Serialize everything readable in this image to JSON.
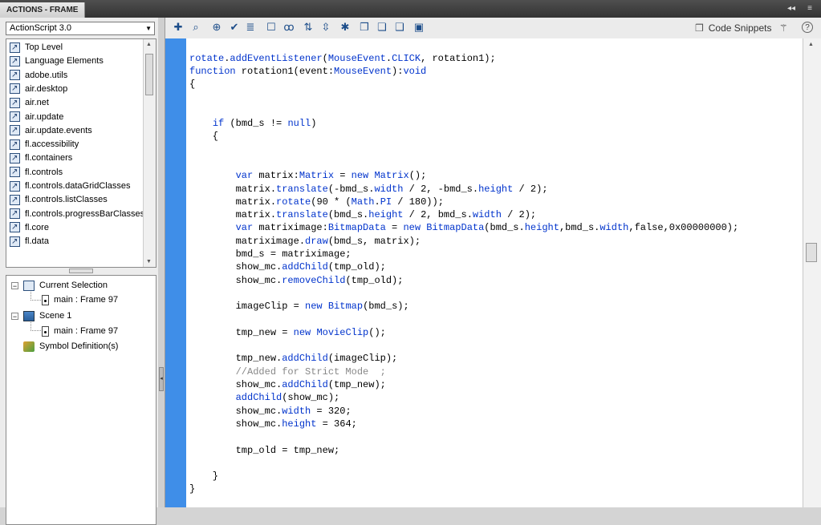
{
  "window": {
    "title": "ACTIONS - FRAME",
    "controls": {
      "collapse": "◂◂",
      "menu": "≡"
    }
  },
  "left_panel": {
    "language_select": {
      "value": "ActionScript 3.0",
      "arrow": "▼"
    },
    "library_items": [
      "Top Level",
      "Language Elements",
      "adobe.utils",
      "air.desktop",
      "air.net",
      "air.update",
      "air.update.events",
      "fl.accessibility",
      "fl.containers",
      "fl.controls",
      "fl.controls.dataGridClasses",
      "fl.controls.listClasses",
      "fl.controls.progressBarClasses",
      "fl.core",
      "fl.data"
    ],
    "tree": {
      "current_selection": "Current Selection",
      "current_frame": "main : Frame 97",
      "scene": "Scene 1",
      "scene_frame": "main : Frame 97",
      "symbol_definitions": "Symbol Definition(s)",
      "expander_minus": "−"
    }
  },
  "toolbar": {
    "code_snippets_label": "Code Snippets",
    "help": "?",
    "buttons": [
      {
        "name": "add-statement",
        "glyph": "✚"
      },
      {
        "name": "find",
        "glyph": "⌕"
      },
      {
        "name": "insert-target-path",
        "glyph": "⊕"
      },
      {
        "name": "check-syntax",
        "glyph": "✔"
      },
      {
        "name": "auto-format",
        "glyph": "≣"
      },
      {
        "name": "show-code-hint",
        "glyph": "☐"
      },
      {
        "name": "debug-options",
        "glyph": "ꝏ"
      },
      {
        "name": "collapse-between-braces",
        "glyph": "⇅"
      },
      {
        "name": "collapse-selection",
        "glyph": "⇳"
      },
      {
        "name": "expand-all",
        "glyph": "✱"
      },
      {
        "name": "apply-block-comment",
        "glyph": "❐"
      },
      {
        "name": "apply-line-comment",
        "glyph": "❏"
      },
      {
        "name": "remove-comment",
        "glyph": "❑"
      },
      {
        "name": "show-hide-toolbox",
        "glyph": "▣"
      }
    ]
  },
  "code_lines": [
    "rotate.addEventListener(MouseEvent.CLICK, rotation1);",
    "function rotation1(event:MouseEvent):void",
    "{",
    "",
    "",
    "    if (bmd_s != null)",
    "    {",
    "",
    "",
    "        var matrix:Matrix = new Matrix();",
    "        matrix.translate(-bmd_s.width / 2, -bmd_s.height / 2);",
    "        matrix.rotate(90 * (Math.PI / 180));",
    "        matrix.translate(bmd_s.height / 2, bmd_s.width / 2);",
    "        var matriximage:BitmapData = new BitmapData(bmd_s.height,bmd_s.width,false,0x00000000);",
    "        matriximage.draw(bmd_s, matrix);",
    "        bmd_s = matriximage;",
    "        show_mc.addChild(tmp_old);",
    "        show_mc.removeChild(tmp_old);",
    "",
    "        imageClip = new Bitmap(bmd_s);",
    "",
    "        tmp_new = new MovieClip();",
    "",
    "        tmp_new.addChild(imageClip);",
    "        //Added for Strict Mode  ;",
    "        show_mc.addChild(tmp_new);",
    "        addChild(show_mc);",
    "        show_mc.width = 320;",
    "        show_mc.height = 364;",
    "",
    "        tmp_old = tmp_new;",
    "",
    "    }",
    "}"
  ],
  "colors": {
    "keyword": "#0033cc",
    "comment": "#888888",
    "gutter": "#3f8ee8"
  },
  "icons": {
    "book": "book-arrow-icon",
    "frame": "frame-icon",
    "scene": "scene-icon",
    "symbol": "symbol-icon",
    "snippets": "code-snippets-icon",
    "wand": "wand-icon"
  }
}
